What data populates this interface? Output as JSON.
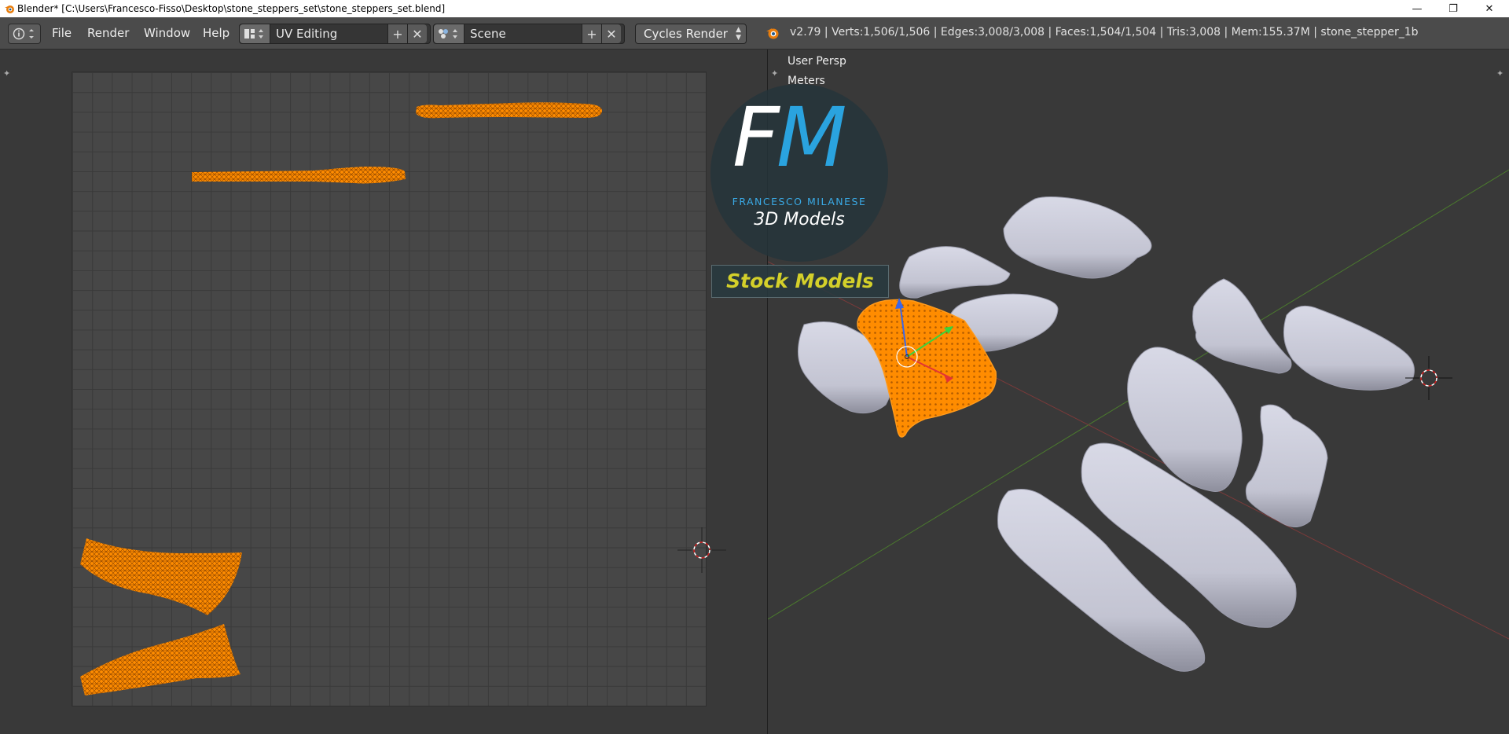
{
  "window": {
    "title": "Blender* [C:\\Users\\Francesco-Fisso\\Desktop\\stone_steppers_set\\stone_steppers_set.blend]",
    "min_glyph": "—",
    "max_glyph": "❐",
    "close_glyph": "✕"
  },
  "menu": {
    "items": [
      "File",
      "Render",
      "Window",
      "Help"
    ]
  },
  "layout_selector": {
    "value": "UV Editing",
    "add_glyph": "+",
    "remove_glyph": "✕"
  },
  "scene_selector": {
    "value": "Scene",
    "add_glyph": "+",
    "remove_glyph": "✕"
  },
  "render_engine": {
    "value": "Cycles Render"
  },
  "stats": "v2.79 | Verts:1,506/1,506 | Edges:3,008/3,008 | Faces:1,504/1,504 | Tris:3,008 | Mem:155.37M | stone_stepper_1b",
  "viewport": {
    "view_label": "User Persp",
    "units_label": "Meters"
  },
  "watermark": {
    "letter_f": "F",
    "letter_m": "M",
    "name": "FRANCESCO MILANESE",
    "tagline": "3D Models",
    "badge": "Stock Models"
  },
  "colors": {
    "selection": "#ff8c00",
    "stone": "#c8c9d6",
    "header": "#4b4b4b",
    "background": "#393939",
    "fm_blue": "#2aa3df",
    "badge_text": "#d4d02a"
  }
}
